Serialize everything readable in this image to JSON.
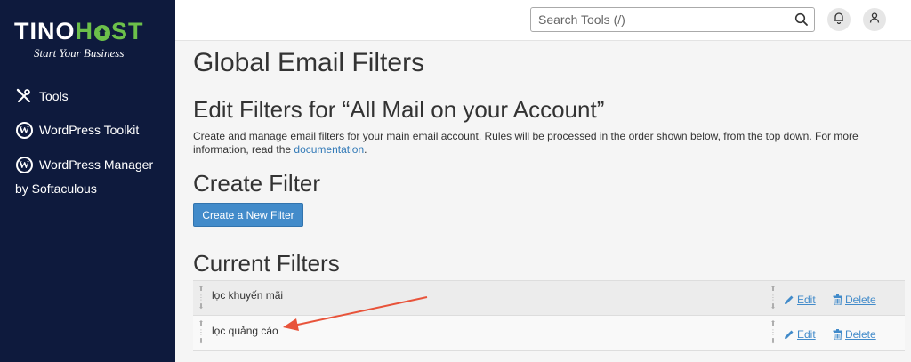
{
  "brand": {
    "name_part1": "TINO",
    "name_part2_a": "H",
    "name_part2_b": "ST",
    "tagline": "Start Your Business",
    "accent_color": "#6cc04a"
  },
  "sidebar": {
    "items": [
      {
        "label": "Tools",
        "icon": "tools-icon"
      },
      {
        "label": "WordPress Toolkit",
        "icon": "wordpress-icon"
      },
      {
        "label": "WordPress Manager",
        "icon": "wordpress-icon"
      }
    ],
    "softaculous_suffix": "by Softaculous"
  },
  "header": {
    "search_placeholder": "Search Tools (/)",
    "search_value": ""
  },
  "main": {
    "page_title": "Global Email Filters",
    "edit_heading": "Edit Filters for “All Mail on your Account”",
    "description": "Create and manage email filters for your main email account. Rules will be processed in the order shown below, from the top down. For more information, read the ",
    "doc_link": "documentation",
    "description_end": ".",
    "create_heading": "Create Filter",
    "create_button": "Create a New Filter",
    "current_heading": "Current Filters"
  },
  "filters": {
    "rows": [
      {
        "name": "lọc khuyến mãi",
        "edit": "Edit",
        "delete": "Delete"
      },
      {
        "name": "lọc quảng cáo",
        "edit": "Edit",
        "delete": "Delete"
      }
    ]
  },
  "colors": {
    "sidebar_bg": "#0e1a3d",
    "primary_button": "#428bca",
    "link": "#337ab7",
    "annotation_arrow": "#e8533a"
  }
}
